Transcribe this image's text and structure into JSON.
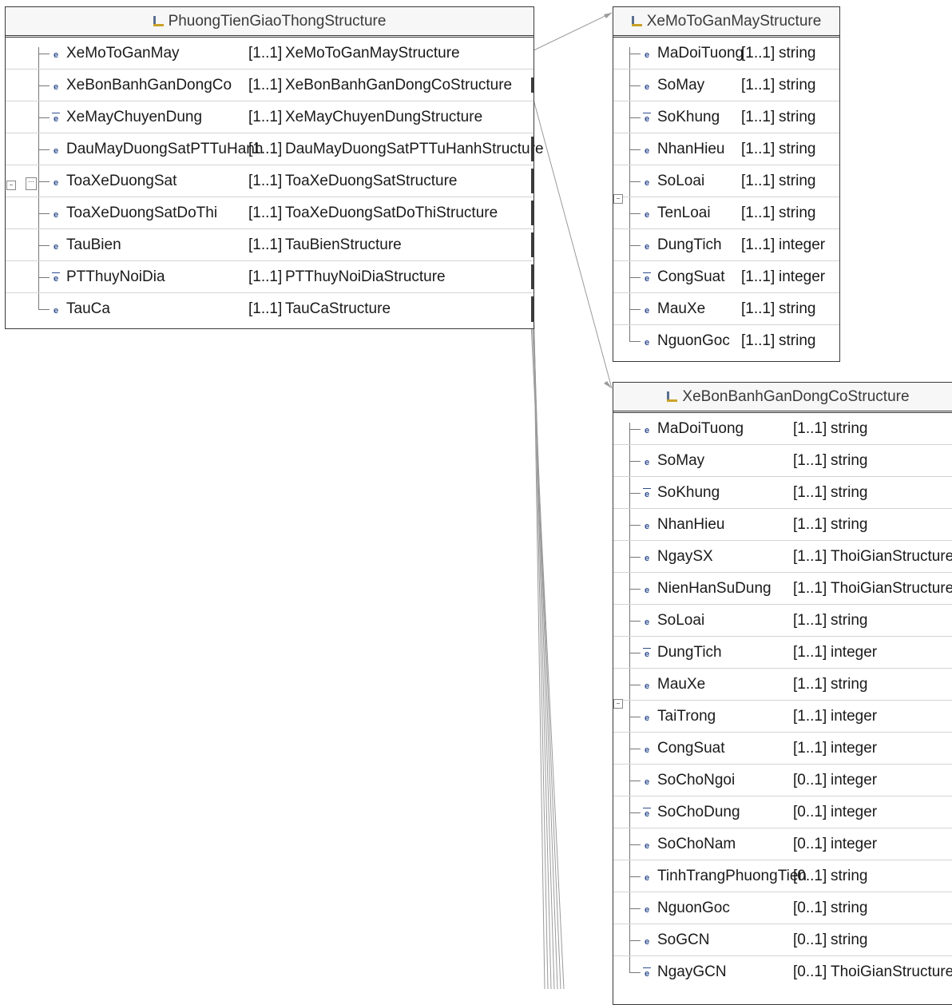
{
  "colors": {
    "border": "#3a3a3a",
    "icon": "#2f4f8f",
    "connector": "#9a9a9a"
  },
  "boxes": [
    {
      "title": "PhuongTienGiaoThongStructure",
      "rows": [
        {
          "name": "XeMoToGanMay",
          "card": "[1..1]",
          "type": "XeMoToGanMayStructure",
          "icon": "element"
        },
        {
          "name": "XeBonBanhGanDongCo",
          "card": "[1..1]",
          "type": "XeBonBanhGanDongCoStructure",
          "icon": "element"
        },
        {
          "name": "XeMayChuyenDung",
          "card": "[1..1]",
          "type": "XeMayChuyenDungStructure",
          "icon": "element-optional"
        },
        {
          "name": "DauMayDuongSatPTTuHanh",
          "card": "[1..1]",
          "type": "DauMayDuongSatPTTuHanhStructure",
          "icon": "element"
        },
        {
          "name": "ToaXeDuongSat",
          "card": "[1..1]",
          "type": "ToaXeDuongSatStructure",
          "icon": "element"
        },
        {
          "name": "ToaXeDuongSatDoThi",
          "card": "[1..1]",
          "type": "ToaXeDuongSatDoThiStructure",
          "icon": "element"
        },
        {
          "name": "TauBien",
          "card": "[1..1]",
          "type": "TauBienStructure",
          "icon": "element"
        },
        {
          "name": "PTThuyNoiDia",
          "card": "[1..1]",
          "type": "PTThuyNoiDiaStructure",
          "icon": "element-optional"
        },
        {
          "name": "TauCa",
          "card": "[1..1]",
          "type": "TauCaStructure",
          "icon": "element"
        }
      ]
    },
    {
      "title": "XeMoToGanMayStructure",
      "rows": [
        {
          "name": "MaDoiTuong",
          "card": "[1..1]",
          "type": "string",
          "icon": "element"
        },
        {
          "name": "SoMay",
          "card": "[1..1]",
          "type": "string",
          "icon": "element"
        },
        {
          "name": "SoKhung",
          "card": "[1..1]",
          "type": "string",
          "icon": "element-optional"
        },
        {
          "name": "NhanHieu",
          "card": "[1..1]",
          "type": "string",
          "icon": "element"
        },
        {
          "name": "SoLoai",
          "card": "[1..1]",
          "type": "string",
          "icon": "element"
        },
        {
          "name": "TenLoai",
          "card": "[1..1]",
          "type": "string",
          "icon": "element"
        },
        {
          "name": "DungTich",
          "card": "[1..1]",
          "type": "integer",
          "icon": "element"
        },
        {
          "name": "CongSuat",
          "card": "[1..1]",
          "type": "integer",
          "icon": "element-optional"
        },
        {
          "name": "MauXe",
          "card": "[1..1]",
          "type": "string",
          "icon": "element"
        },
        {
          "name": "NguonGoc",
          "card": "[1..1]",
          "type": "string",
          "icon": "element"
        }
      ]
    },
    {
      "title": "XeBonBanhGanDongCoStructure",
      "rows": [
        {
          "name": "MaDoiTuong",
          "card": "[1..1]",
          "type": "string",
          "icon": "element"
        },
        {
          "name": "SoMay",
          "card": "[1..1]",
          "type": "string",
          "icon": "element"
        },
        {
          "name": "SoKhung",
          "card": "[1..1]",
          "type": "string",
          "icon": "element-optional"
        },
        {
          "name": "NhanHieu",
          "card": "[1..1]",
          "type": "string",
          "icon": "element"
        },
        {
          "name": "NgaySX",
          "card": "[1..1]",
          "type": "ThoiGianStructure",
          "icon": "element"
        },
        {
          "name": "NienHanSuDung",
          "card": "[1..1]",
          "type": "ThoiGianStructure",
          "icon": "element"
        },
        {
          "name": "SoLoai",
          "card": "[1..1]",
          "type": "string",
          "icon": "element"
        },
        {
          "name": "DungTich",
          "card": "[1..1]",
          "type": "integer",
          "icon": "element-optional"
        },
        {
          "name": "MauXe",
          "card": "[1..1]",
          "type": "string",
          "icon": "element"
        },
        {
          "name": "TaiTrong",
          "card": "[1..1]",
          "type": "integer",
          "icon": "element"
        },
        {
          "name": "CongSuat",
          "card": "[1..1]",
          "type": "integer",
          "icon": "element"
        },
        {
          "name": "SoChoNgoi",
          "card": "[0..1]",
          "type": "integer",
          "icon": "element"
        },
        {
          "name": "SoChoDung",
          "card": "[0..1]",
          "type": "integer",
          "icon": "element-optional"
        },
        {
          "name": "SoChoNam",
          "card": "[0..1]",
          "type": "integer",
          "icon": "element"
        },
        {
          "name": "TinhTrangPhuongTien",
          "card": "[0..1]",
          "type": "string",
          "icon": "element"
        },
        {
          "name": "NguonGoc",
          "card": "[0..1]",
          "type": "string",
          "icon": "element"
        },
        {
          "name": "SoGCN",
          "card": "[0..1]",
          "type": "string",
          "icon": "element"
        },
        {
          "name": "NgayGCN",
          "card": "[0..1]",
          "type": "ThoiGianStructure",
          "icon": "element-optional"
        }
      ]
    }
  ]
}
